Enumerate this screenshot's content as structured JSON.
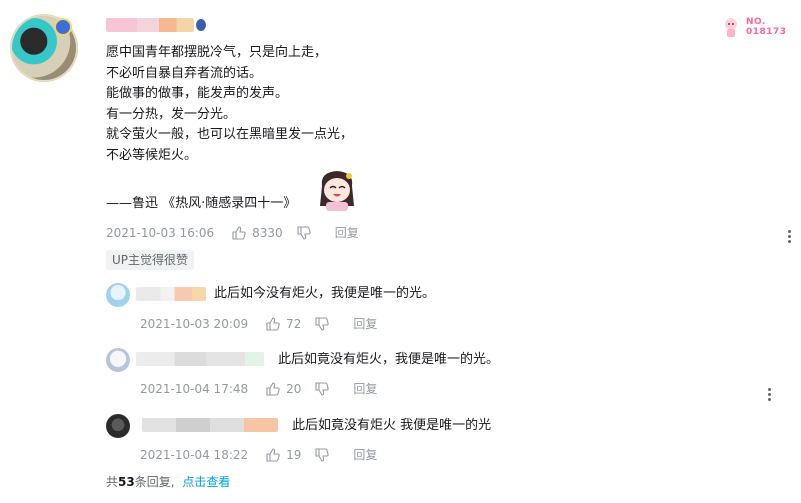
{
  "comment": {
    "lines": [
      "愿中国青年都摆脱冷气，只是向上走，",
      "不必听自暴自弃者流的话。",
      "能做事的做事，能发声的发声。",
      "有一分热，发一分光。",
      "就令萤火一般，也可以在黑暗里发一点光，",
      "不必等候炬火。"
    ],
    "signature": "——鲁迅 《热风·随感录四十一》",
    "date": "2021-10-03 16:06",
    "likes": "8330",
    "reply_label": "回复",
    "up_tag": "UP主觉得很赞",
    "floor_label": "NO.",
    "floor_number": "018173"
  },
  "replies": [
    {
      "text": "此后如今没有炬火，我便是唯一的光。",
      "date": "2021-10-03 20:09",
      "likes": "72",
      "reply_label": "回复"
    },
    {
      "text": "此后如竟没有炬火，我便是唯一的光。",
      "date": "2021-10-04 17:48",
      "likes": "20",
      "reply_label": "回复"
    },
    {
      "text": "此后如竟没有炬火 我便是唯一的光",
      "date": "2021-10-04 18:22",
      "likes": "19",
      "reply_label": "回复"
    }
  ],
  "footer": {
    "prefix": "共",
    "count": "53",
    "suffix": "条回复,",
    "link": "点击查看"
  },
  "icons": [
    "like-icon",
    "dislike-icon",
    "more-icon",
    "sticker-icon",
    "floor-badge-icon"
  ],
  "colors": {
    "link": "#00a1d6",
    "muted": "#9499a0",
    "floor": "#ff6699"
  }
}
